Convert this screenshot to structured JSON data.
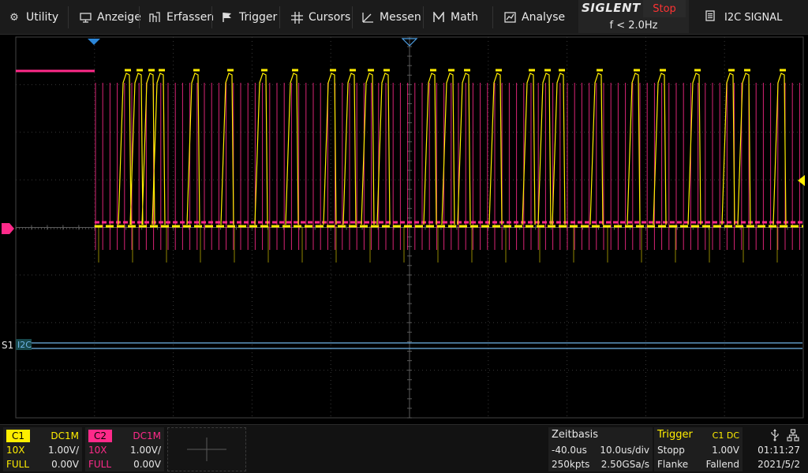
{
  "menu": {
    "utility": "Utility",
    "anzeige": "Anzeige",
    "erfassen": "Erfassen",
    "trigger": "Trigger",
    "cursors": "Cursors",
    "messen": "Messen",
    "math": "Math",
    "analyse": "Analyse"
  },
  "brand": {
    "logo": "SIGLENT",
    "run_state": "Stop",
    "trigger_freq": "f < 2.0Hz"
  },
  "decode": {
    "title": "I2C SIGNAL",
    "bus_label": "S1",
    "bus_protocol": "I2C"
  },
  "colors": {
    "ch1": "#ffee00",
    "ch2": "#ff2a8a",
    "bus": "#6fb4e6",
    "grid": "#3a3a3a",
    "run_state": "#ff3333",
    "trigger_marker": "#2c86d8"
  },
  "ch1": {
    "name": "C1",
    "coupling": "DC1M",
    "probe": "10X",
    "scale": "1.00V/",
    "bandwidth": "FULL",
    "offset": "0.00V"
  },
  "ch2": {
    "name": "C2",
    "coupling": "DC1M",
    "probe": "10X",
    "scale": "1.00V/",
    "bandwidth": "FULL",
    "offset": "0.00V"
  },
  "timebase": {
    "title": "Zeitbasis",
    "delay": "-40.0us",
    "scale": "10.0us/div",
    "memory": "250kpts",
    "sample_rate": "2.50GSa/s"
  },
  "trigger": {
    "title": "Trigger",
    "source": "C1 DC",
    "mode": "Stopp",
    "level": "1.00V",
    "type": "Flanke",
    "slope": "Fallend"
  },
  "clock": {
    "time": "01:11:27",
    "date": "2021/5/2"
  }
}
